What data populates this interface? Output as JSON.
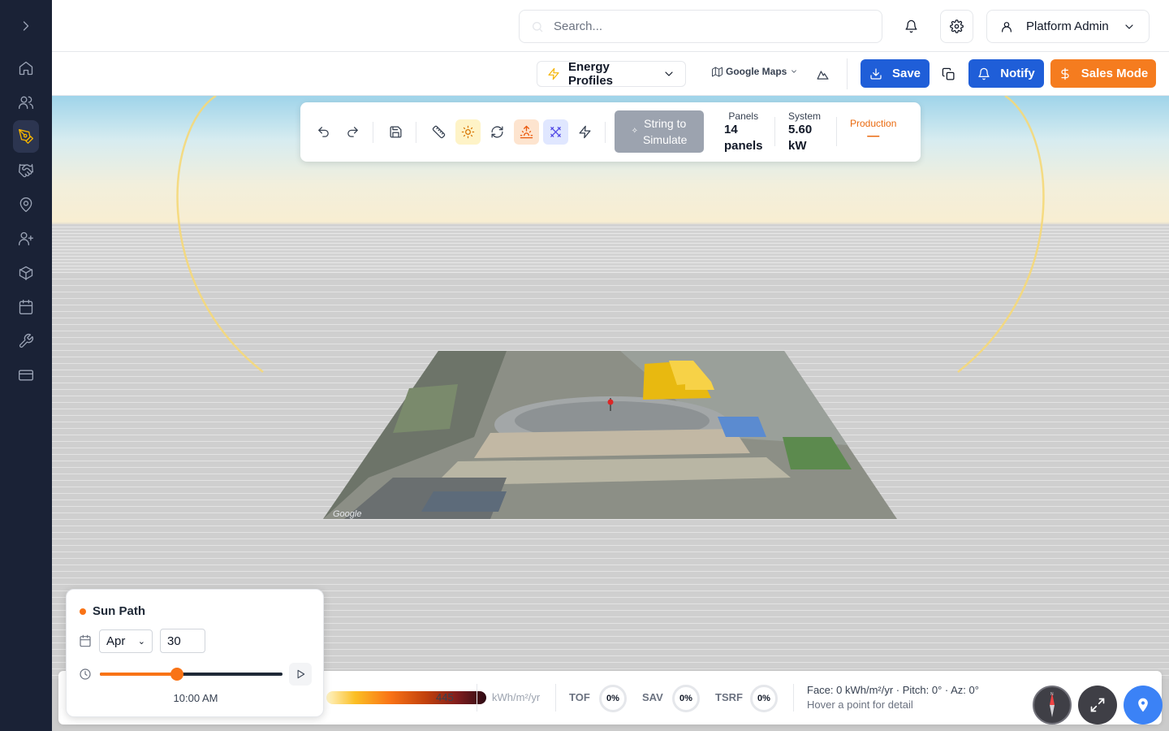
{
  "header": {
    "search_placeholder": "Search...",
    "user_name": "Platform Admin"
  },
  "toolbar": {
    "energy_profiles_label": "Energy Profiles",
    "maps_provider_label": "Google Maps",
    "save_label": "Save",
    "notify_label": "Notify",
    "sales_mode_label": "Sales Mode"
  },
  "design_panel": {
    "string_button_line1": "String to",
    "string_button_line2": "Simulate",
    "panels_key": "Panels",
    "panels_value_line1": "14",
    "panels_value_line2": "panels",
    "system_key": "System",
    "system_value_line1": "5.60",
    "system_value_line2": "kW",
    "production_key": "Production",
    "production_value": "—"
  },
  "bottom_bar": {
    "scale_max": "445",
    "unit": "kWh/m²/yr",
    "tof_label": "TOF",
    "tof_value": "0%",
    "sav_label": "SAV",
    "sav_value": "0%",
    "tsrf_label": "TSRF",
    "tsrf_value": "0%",
    "face_info": "Face: 0 kWh/m²/yr · Pitch: 0° · Az: 0°",
    "hover_hint": "Hover a point for detail"
  },
  "sun_path": {
    "title": "Sun Path",
    "month": "Apr",
    "day": "30",
    "time_label": "10:00 AM",
    "time_fraction": 0.42
  },
  "colors": {
    "sidebar_bg": "#1a2236",
    "active_icon": "#f5b400",
    "primary_blue": "#1f5ed8",
    "sales_orange": "#f57c1f",
    "sun_accent": "#f97316"
  },
  "sidebar_icons": [
    "chevron-right-icon",
    "home-icon",
    "users-icon",
    "pen-tool-icon",
    "handshake-icon",
    "map-pin-icon",
    "user-plus-icon",
    "package-icon",
    "calendar-icon",
    "wrench-icon",
    "credit-card-icon"
  ]
}
